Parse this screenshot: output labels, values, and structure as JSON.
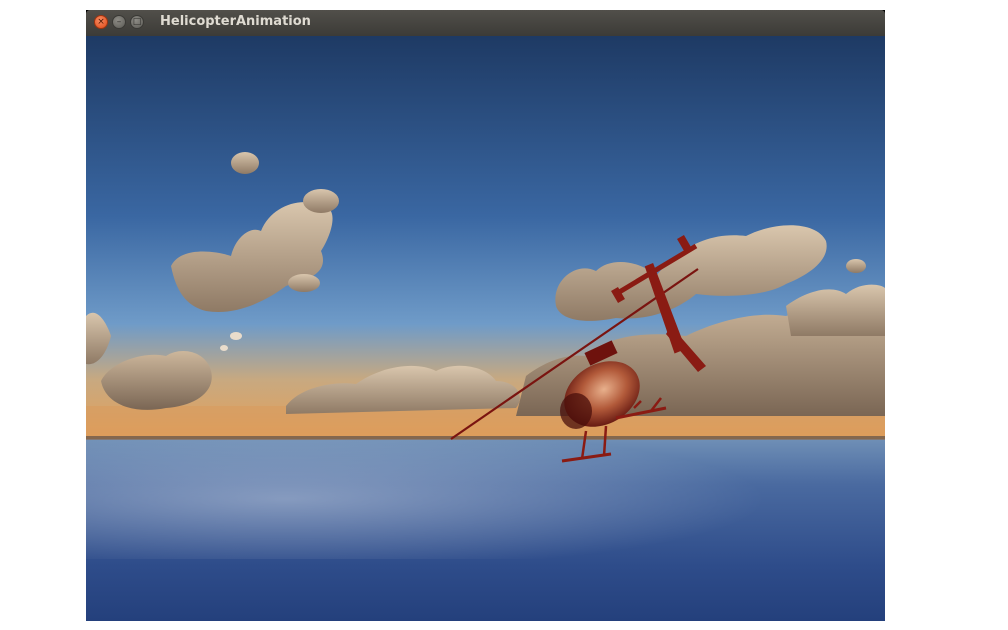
{
  "window": {
    "title": "HelicopterAnimation",
    "buttons": {
      "close_glyph": "×",
      "minimize_glyph": "–",
      "maximize_glyph": "□"
    }
  },
  "scene": {
    "subject": "helicopter",
    "colors": {
      "sky_top": "#1f3b66",
      "sky_mid": "#3c6aa6",
      "horizon_glow": "#e2a15c",
      "sea": "#2f4f8c",
      "helicopter_body": "#8e1a12"
    }
  }
}
